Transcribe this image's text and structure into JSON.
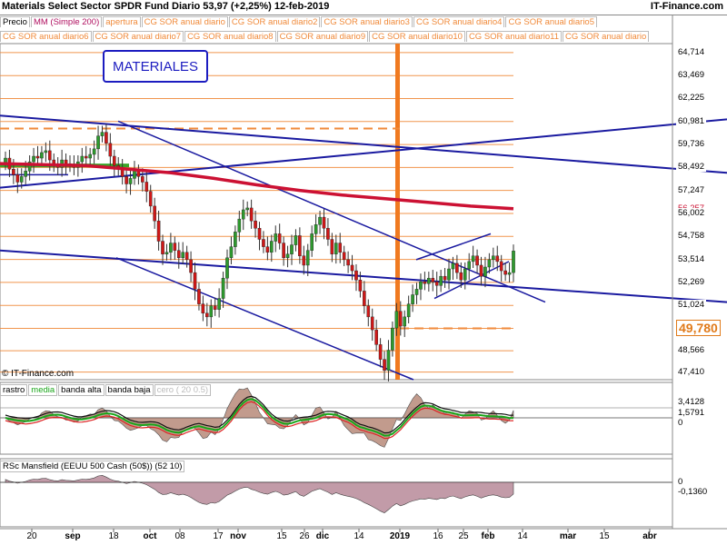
{
  "header": {
    "title": "Materials Select Sector SPDR Fund   Diario   53,97 (+2,25%)   12-feb-2019",
    "brand": "IT-Finance.com"
  },
  "legend_row1": [
    "Precio",
    "MM (Simple 200)",
    "apertura",
    "CG SOR anual diario",
    "CG SOR anual diario2",
    "CG SOR anual diario3",
    "CG SOR anual diario4",
    "CG SOR anual diario5"
  ],
  "legend_row2": [
    "CG SOR anual diario6",
    "CG SOR anual diario7",
    "CG SOR anual diario8",
    "CG SOR anual diario9",
    "CG SOR anual diario10",
    "CG SOR anual diario11",
    "CG SOR anual diario"
  ],
  "annotation_box": "MATERIALES",
  "watermark": "© IT-Finance.com",
  "osc_legend": [
    "rastro",
    "media",
    "banda alta",
    "banda baja",
    "cero ( 20 0.5)"
  ],
  "rsc_legend": "RSc Mansfield (EEUU 500 Cash (50$)) (52 10)",
  "colors": {
    "up": "#2e9a2e",
    "down": "#d01818",
    "ma": "#cc1133",
    "trend": "#1a1aa0",
    "level": "#f08a3a",
    "highlight": "#3aa52a"
  },
  "price_axis": {
    "labels": [
      "64,714",
      "63,469",
      "62,225",
      "60,981",
      "59,736",
      "58,492",
      "57,247",
      "56,257",
      "56,002",
      "54,758",
      "53,514",
      "52,269",
      "51,024",
      "49,780",
      "48,566",
      "47,410"
    ],
    "current": "49,780"
  },
  "osc_axis": [
    "3,4128",
    "1,5791",
    "0"
  ],
  "rsc_axis": [
    "0",
    "-0,1360"
  ],
  "x_axis": [
    "20",
    "sep",
    "18",
    "oct",
    "08",
    "17",
    "nov",
    "15",
    "26",
    "dic",
    "14",
    "2019",
    "16",
    "25",
    "feb",
    "14",
    "mar",
    "15",
    "abr"
  ],
  "chart_data": {
    "type": "candlestick",
    "title": "Materials Select Sector SPDR Fund",
    "period": "Diario",
    "last_close": 53.97,
    "change_pct": 2.25,
    "date": "12-feb-2019",
    "y_range": [
      47.0,
      65.2
    ],
    "levels": [
      64.714,
      63.469,
      62.225,
      60.981,
      59.736,
      58.492,
      57.247,
      56.002,
      54.758,
      53.514,
      52.269,
      51.024,
      49.78,
      48.566,
      47.41
    ],
    "ma200": [
      58.7,
      58.65,
      58.6,
      58.4,
      58.2,
      57.9,
      57.55,
      57.25,
      57.0,
      56.8,
      56.6,
      56.4,
      56.26
    ],
    "closes": [
      59.0,
      58.4,
      58.1,
      57.7,
      58.0,
      58.3,
      58.8,
      59.1,
      59.0,
      59.3,
      59.4,
      58.9,
      58.6,
      58.5,
      58.9,
      58.7,
      58.6,
      58.5,
      58.8,
      59.1,
      59.0,
      59.2,
      59.5,
      60.2,
      60.4,
      59.8,
      59.1,
      58.6,
      58.4,
      58.0,
      57.6,
      57.9,
      58.3,
      58.0,
      57.7,
      57.2,
      56.4,
      55.6,
      54.5,
      53.8,
      53.9,
      54.4,
      54.0,
      53.6,
      53.9,
      53.5,
      52.8,
      51.9,
      51.1,
      50.6,
      50.4,
      51.0,
      50.8,
      51.4,
      52.5,
      53.6,
      54.2,
      55.0,
      55.7,
      56.2,
      56.3,
      55.6,
      55.2,
      54.6,
      54.2,
      53.9,
      54.5,
      54.9,
      54.4,
      53.6,
      53.8,
      54.3,
      54.8,
      53.7,
      53.2,
      54.0,
      54.9,
      55.4,
      55.8,
      55.2,
      54.6,
      53.8,
      54.4,
      53.9,
      53.5,
      53.2,
      52.9,
      52.4,
      51.8,
      51.0,
      50.4,
      49.7,
      48.9,
      48.1,
      47.5,
      48.6,
      49.8,
      50.7,
      49.9,
      50.4,
      51.1,
      51.6,
      51.9,
      52.3,
      52.2,
      52.5,
      52.3,
      52.1,
      52.6,
      52.4,
      53.0,
      53.3,
      52.8,
      52.4,
      53.0,
      53.4,
      53.7,
      53.2,
      52.6,
      53.1,
      53.5,
      53.7,
      53.4,
      52.9,
      52.7,
      52.8,
      53.97
    ]
  }
}
